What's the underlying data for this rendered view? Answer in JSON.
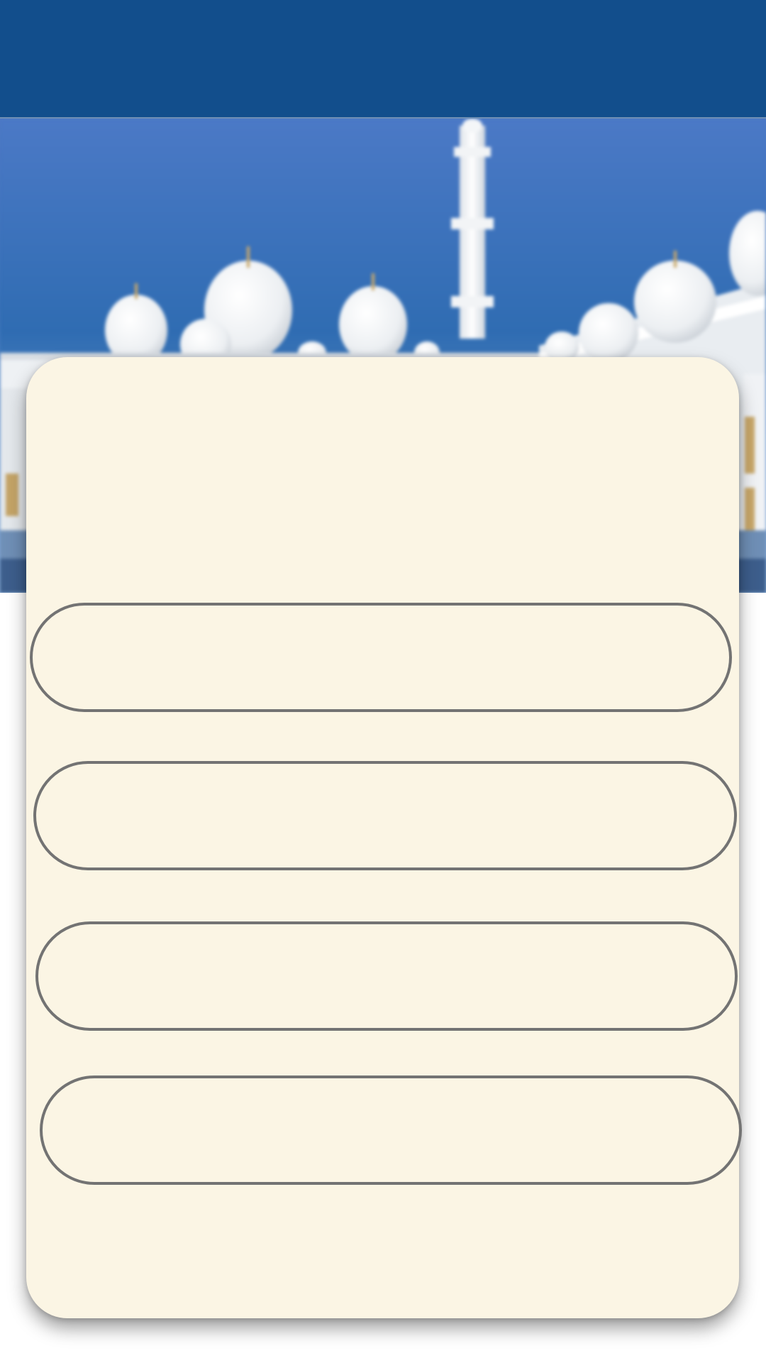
{
  "app_bar": {
    "title": ""
  },
  "hero": {
    "image": "mosque-photo"
  },
  "card": {
    "options": [
      {
        "label": ""
      },
      {
        "label": ""
      },
      {
        "label": ""
      },
      {
        "label": ""
      }
    ]
  },
  "colors": {
    "app_bar": "#124e8c",
    "card_background": "#fbf5e4",
    "button_border": "#737373",
    "sky": "#3a72b8"
  }
}
